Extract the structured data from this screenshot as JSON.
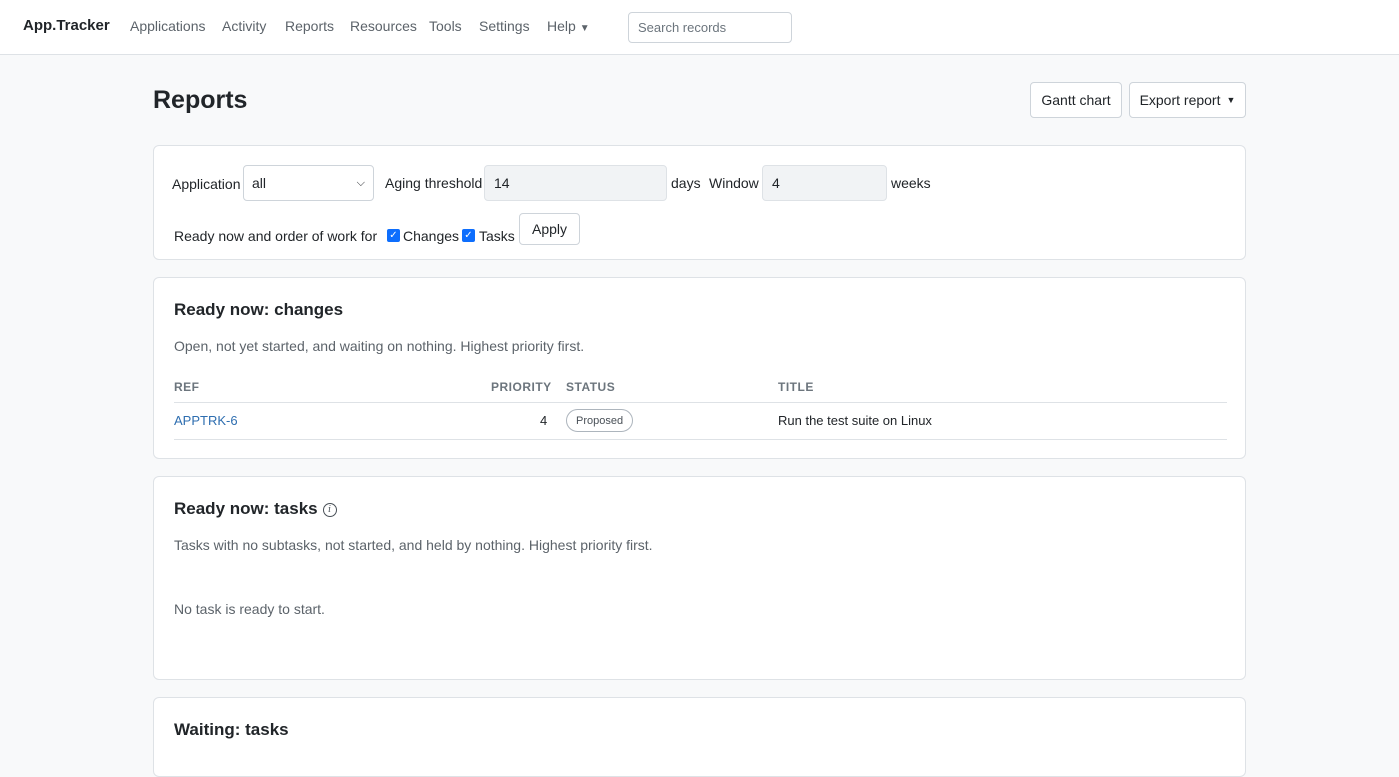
{
  "nav": {
    "brand": "App.Tracker",
    "links": [
      "Applications",
      "Activity",
      "Reports",
      "Resources",
      "Tools",
      "Settings",
      "Help"
    ],
    "search_placeholder": "Search records"
  },
  "page": {
    "title": "Reports",
    "gantt_label": "Gantt chart",
    "export_label": "Export report"
  },
  "filters": {
    "application_label": "Application",
    "application_value": "all",
    "aging_label": "Aging threshold",
    "aging_value": "14",
    "aging_unit": "days",
    "window_label": "Window",
    "window_value": "4",
    "window_unit": "weeks",
    "ready_label": "Ready now and order of work for",
    "changes_label": "Changes",
    "changes_checked": true,
    "tasks_label": "Tasks",
    "tasks_checked": true,
    "apply_label": "Apply"
  },
  "ready_changes": {
    "title": "Ready now: changes",
    "description": "Open, not yet started, and waiting on nothing. Highest priority first.",
    "columns": [
      "REF",
      "PRIORITY",
      "STATUS",
      "TITLE"
    ],
    "rows": [
      {
        "ref": "APPTRK-6",
        "priority": "4",
        "status": "Proposed",
        "title": "Run the test suite on Linux"
      }
    ]
  },
  "ready_tasks": {
    "title": "Ready now: tasks",
    "description": "Tasks with no subtasks, not started, and held by nothing. Highest priority first.",
    "empty_message": "No task is ready to start."
  },
  "waiting_tasks": {
    "title": "Waiting: tasks"
  }
}
